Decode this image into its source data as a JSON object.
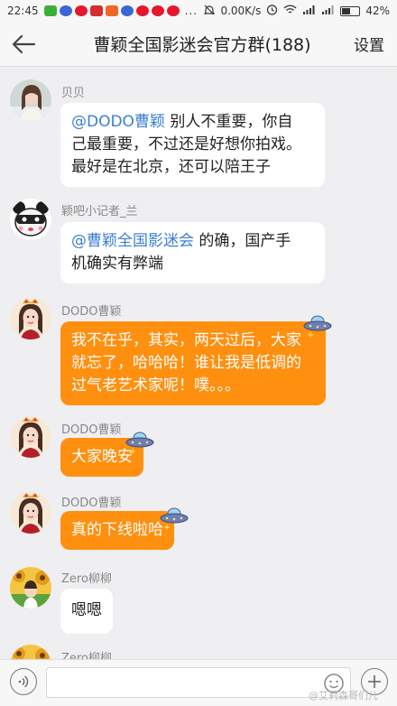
{
  "status_bar": {
    "time": "22:45",
    "more": "...",
    "net_speed": "0.00K/s",
    "battery": "42%"
  },
  "header": {
    "title": "曹颖全国影迷会官方群(188)",
    "settings": "设置"
  },
  "messages": [
    {
      "sender": "贝贝",
      "mention": "@DODO曹颖",
      "lines": [
        "别人不重要，你自",
        "己最重要，不过还是好想你拍戏。",
        "最好是在北京，还可以陪王子"
      ],
      "style": "white"
    },
    {
      "sender": "颖吧小记者_兰",
      "mention": "@曹颖全国影迷会",
      "lines": [
        " 的确，国产手",
        "机确实有弊端"
      ],
      "style": "white"
    },
    {
      "sender": "DODO曹颖",
      "lines": [
        "我不在乎，其实，两天过后，大家",
        "就忘了，哈哈哈！谁让我是低调的",
        "过气老艺术家呢！噗。。。"
      ],
      "style": "orange"
    },
    {
      "sender": "DODO曹颖",
      "lines": [
        "大家晚安"
      ],
      "style": "orange"
    },
    {
      "sender": "DODO曹颖",
      "lines": [
        "真的下线啦哈"
      ],
      "style": "orange"
    },
    {
      "sender": "Zero柳柳",
      "lines": [
        "嗯嗯"
      ],
      "style": "white"
    },
    {
      "sender": "Zero柳柳"
    }
  ],
  "watermark": "@艾莉森哥们儿"
}
